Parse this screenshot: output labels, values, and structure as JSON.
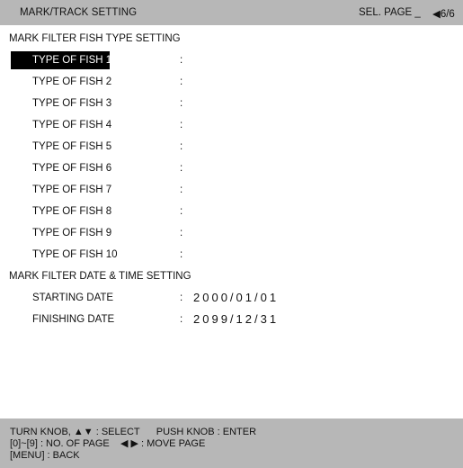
{
  "header": {
    "title": "MARK/TRACK SETTING",
    "sel_page": "SEL. PAGE _",
    "page_indicator": "◀6/6"
  },
  "fish_section": {
    "title": "MARK FILTER FISH TYPE SETTING",
    "items": [
      {
        "label": "TYPE OF FISH 1",
        "colon": ":",
        "value": ""
      },
      {
        "label": "TYPE OF FISH 2",
        "colon": ":",
        "value": ""
      },
      {
        "label": "TYPE OF FISH 3",
        "colon": ":",
        "value": ""
      },
      {
        "label": "TYPE OF FISH 4",
        "colon": ":",
        "value": ""
      },
      {
        "label": "TYPE OF FISH 5",
        "colon": ":",
        "value": ""
      },
      {
        "label": "TYPE OF FISH 6",
        "colon": ":",
        "value": ""
      },
      {
        "label": "TYPE OF FISH 7",
        "colon": ":",
        "value": ""
      },
      {
        "label": "TYPE OF FISH 8",
        "colon": ":",
        "value": ""
      },
      {
        "label": "TYPE OF FISH 9",
        "colon": ":",
        "value": ""
      },
      {
        "label": "TYPE OF FISH 10",
        "colon": ":",
        "value": ""
      }
    ]
  },
  "date_section": {
    "title": "MARK FILTER DATE & TIME SETTING",
    "starting_label": "STARTING DATE",
    "starting_colon": ":",
    "starting_value": "2000/01/01",
    "finishing_label": "FINISHING DATE",
    "finishing_colon": ":",
    "finishing_value": "2099/12/31"
  },
  "footer": {
    "line1": "TURN KNOB, ▲▼ : SELECT      PUSH KNOB : ENTER",
    "line2": "[0]~[9] : NO. OF PAGE    ◀ ▶ : MOVE PAGE",
    "line3": "[MENU] : BACK"
  },
  "colors": {
    "bar_bg": "#b7b7b7",
    "selected_bg": "#000000",
    "selected_fg": "#ffffff"
  }
}
